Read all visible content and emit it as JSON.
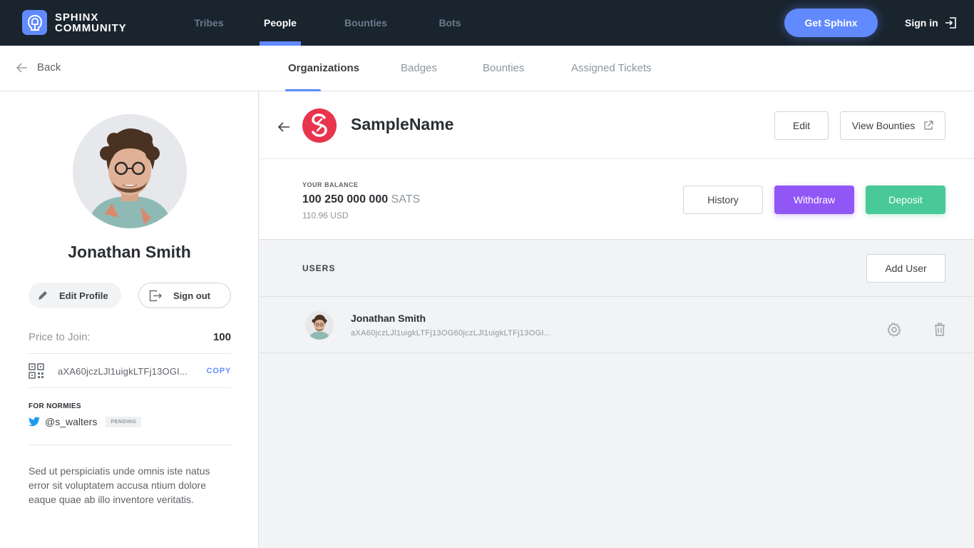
{
  "app": {
    "logo_line1": "SPHINX",
    "logo_line2": "COMMUNITY",
    "accent": "#618aff",
    "navbar_bg": "#1a242e"
  },
  "nav": {
    "items": [
      {
        "label": "Tribes",
        "active": false
      },
      {
        "label": "People",
        "active": true
      },
      {
        "label": "Bounties",
        "active": false
      },
      {
        "label": "Bots",
        "active": false
      }
    ],
    "get_sphinx": "Get Sphinx",
    "sign_in": "Sign in"
  },
  "subheader": {
    "back": "Back",
    "tabs": [
      {
        "label": "Organizations",
        "active": true
      },
      {
        "label": "Badges",
        "active": false
      },
      {
        "label": "Bounties",
        "active": false
      },
      {
        "label": "Assigned Tickets",
        "active": false
      }
    ]
  },
  "profile": {
    "name": "Jonathan Smith",
    "edit_profile": "Edit Profile",
    "sign_out": "Sign out",
    "price_label": "Price to Join:",
    "price_value": "100",
    "address": "aXA60jczLJl1uigkLTFj13OGI...",
    "copy": "COPY",
    "normies_title": "FOR NORMIES",
    "twitter_handle": "@s_walters",
    "twitter_status": "PENDING",
    "bio": "Sed ut perspiciatis unde omnis iste natus error sit voluptatem accusa ntium dolore eaque quae ab illo inventore veritatis."
  },
  "organization": {
    "name": "SampleName",
    "logo_letter": "S",
    "logo_color": "#e8344d",
    "edit": "Edit",
    "view_bounties": "View Bounties",
    "balance_title": "YOUR BALANCE",
    "balance_amount": "100 250 000 000",
    "balance_unit": "SATS",
    "balance_usd": "110.96  USD",
    "history": "History",
    "withdraw": "Withdraw",
    "withdraw_color": "#9157f6",
    "deposit": "Deposit",
    "deposit_color": "#49c998",
    "users_title": "USERS",
    "add_user": "Add User",
    "users": [
      {
        "name": "Jonathan Smith",
        "address": "aXA60jczLJl1uigkLTFj13OG60jczLJl1uigkLTFj13OGI..."
      }
    ]
  }
}
